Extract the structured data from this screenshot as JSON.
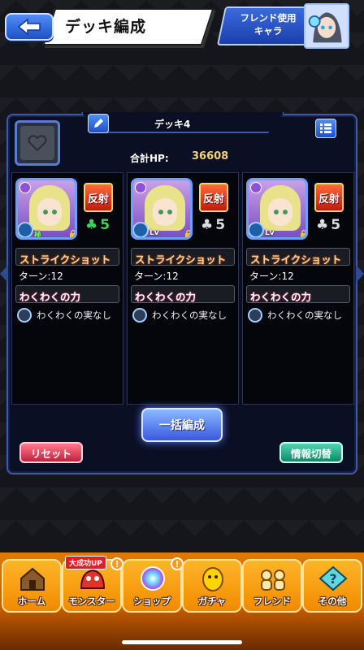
{
  "header": {
    "title": "デッキ編成",
    "friend_button": "フレンド使用\nキャラ",
    "back_icon": "back-arrow-icon"
  },
  "deck": {
    "name": "デッキ4",
    "hp_label": "合計HP:",
    "hp_value": "36608"
  },
  "monsters": [
    {
      "badge": "反射",
      "luck": "5",
      "luck_color": "#3fd35a",
      "skill": "ストライクショット",
      "turn": "ターン:12",
      "ability": "わくわくの力",
      "fruit": "わくわくの実なし",
      "level_badge": "極"
    },
    {
      "badge": "反射",
      "luck": "5",
      "luck_color": "#dddddd",
      "skill": "ストライクショット",
      "turn": "ターン:12",
      "ability": "わくわくの力",
      "fruit": "わくわくの実なし",
      "level_badge": "Lv"
    },
    {
      "badge": "反射",
      "luck": "5",
      "luck_color": "#dddddd",
      "skill": "ストライクショット",
      "turn": "ターン:12",
      "ability": "わくわくの力",
      "fruit": "わくわくの実なし",
      "level_badge": "Lv"
    }
  ],
  "actions": {
    "bulk_edit": "一括編成",
    "reset": "リセット",
    "info_toggle": "情報切替"
  },
  "nav": {
    "promo": "大成功UP",
    "items": [
      {
        "label": "ホーム"
      },
      {
        "label": "モンスター"
      },
      {
        "label": "ショップ"
      },
      {
        "label": "ガチャ"
      },
      {
        "label": "フレンド"
      },
      {
        "label": "その他"
      }
    ],
    "alert": "!"
  }
}
